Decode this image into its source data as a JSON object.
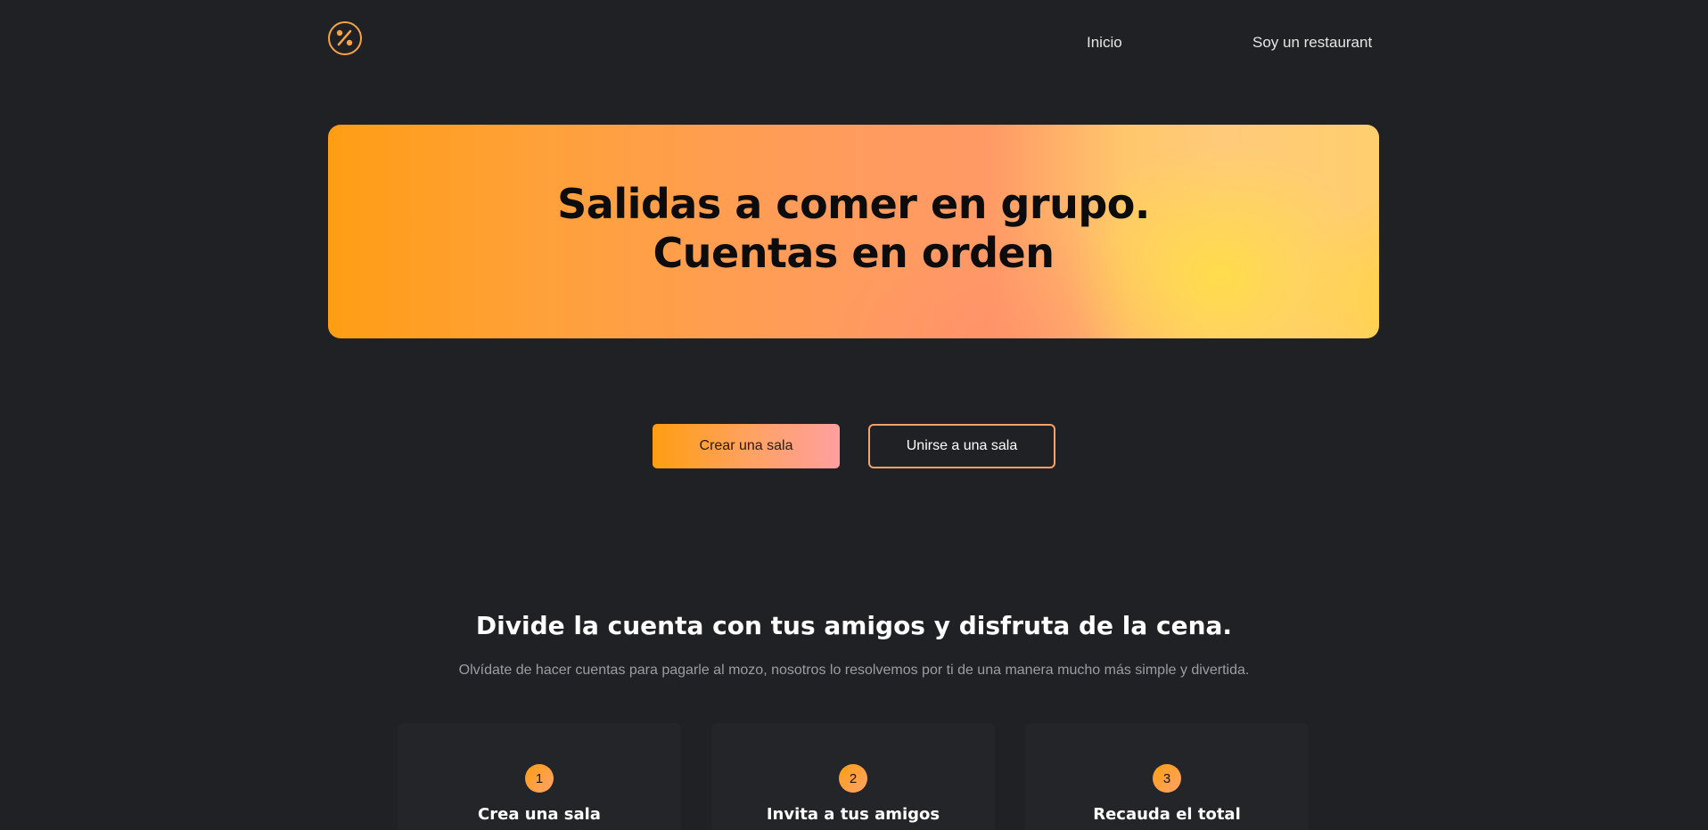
{
  "header": {
    "logo_icon": "percent-icon",
    "nav": {
      "inicio": "Inicio",
      "restaurant": "Soy un restaurant"
    }
  },
  "hero": {
    "title_line1": "Salidas a comer en grupo.",
    "title_line2": "Cuentas en orden"
  },
  "actions": {
    "create_label": "Crear una sala",
    "join_label": "Unirse a una sala"
  },
  "section": {
    "title": "Divide la cuenta con tus amigos y disfruta de la cena.",
    "subtitle": "Olvídate de hacer cuentas para pagarle al mozo, nosotros lo resolvemos por ti de una manera mucho más simple y divertida."
  },
  "steps": [
    {
      "number": "1",
      "title": "Crea una sala"
    },
    {
      "number": "2",
      "title": "Invita a tus amigos"
    },
    {
      "number": "3",
      "title": "Recauda el total"
    }
  ],
  "colors": {
    "background": "#1f2124",
    "accent": "#ff9e12",
    "accent_pink": "#ff9fa0",
    "logo": "#f6a245"
  }
}
